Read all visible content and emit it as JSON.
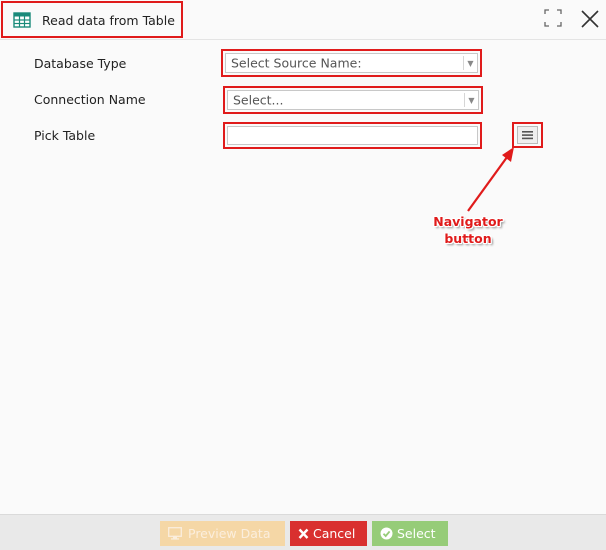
{
  "window": {
    "title": "Read data from Table"
  },
  "form": {
    "database_type": {
      "label": "Database Type",
      "value": "Select Source Name:"
    },
    "connection_name": {
      "label": "Connection Name",
      "value": "Select..."
    },
    "pick_table": {
      "label": "Pick Table",
      "value": ""
    }
  },
  "annotation": {
    "line1": "Navigator",
    "line2": "button",
    "color": "#e01b1b"
  },
  "footer": {
    "preview_label": "Preview Data",
    "cancel_label": "Cancel",
    "select_label": "Select"
  },
  "colors": {
    "highlight": "#e01b1b",
    "preview_button": "#f5d7a6",
    "cancel_button": "#d9302f",
    "select_button": "#96cc78",
    "icon_teal": "#1a8a7a"
  }
}
